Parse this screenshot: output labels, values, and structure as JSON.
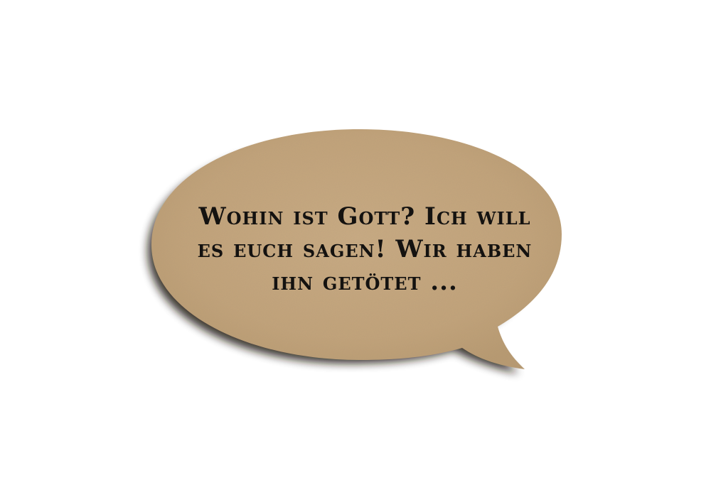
{
  "quote": {
    "lines": [
      "Wohin ist Gott? Ich will",
      "es euch sagen! Wir haben",
      "ihn getötet ..."
    ]
  },
  "colors": {
    "background": "#ffffff",
    "bubble_fill": "#c4a57d",
    "bubble_shadow": "#1a1410",
    "text": "#141210"
  },
  "icons": {
    "bubble": "speech-bubble-icon"
  }
}
